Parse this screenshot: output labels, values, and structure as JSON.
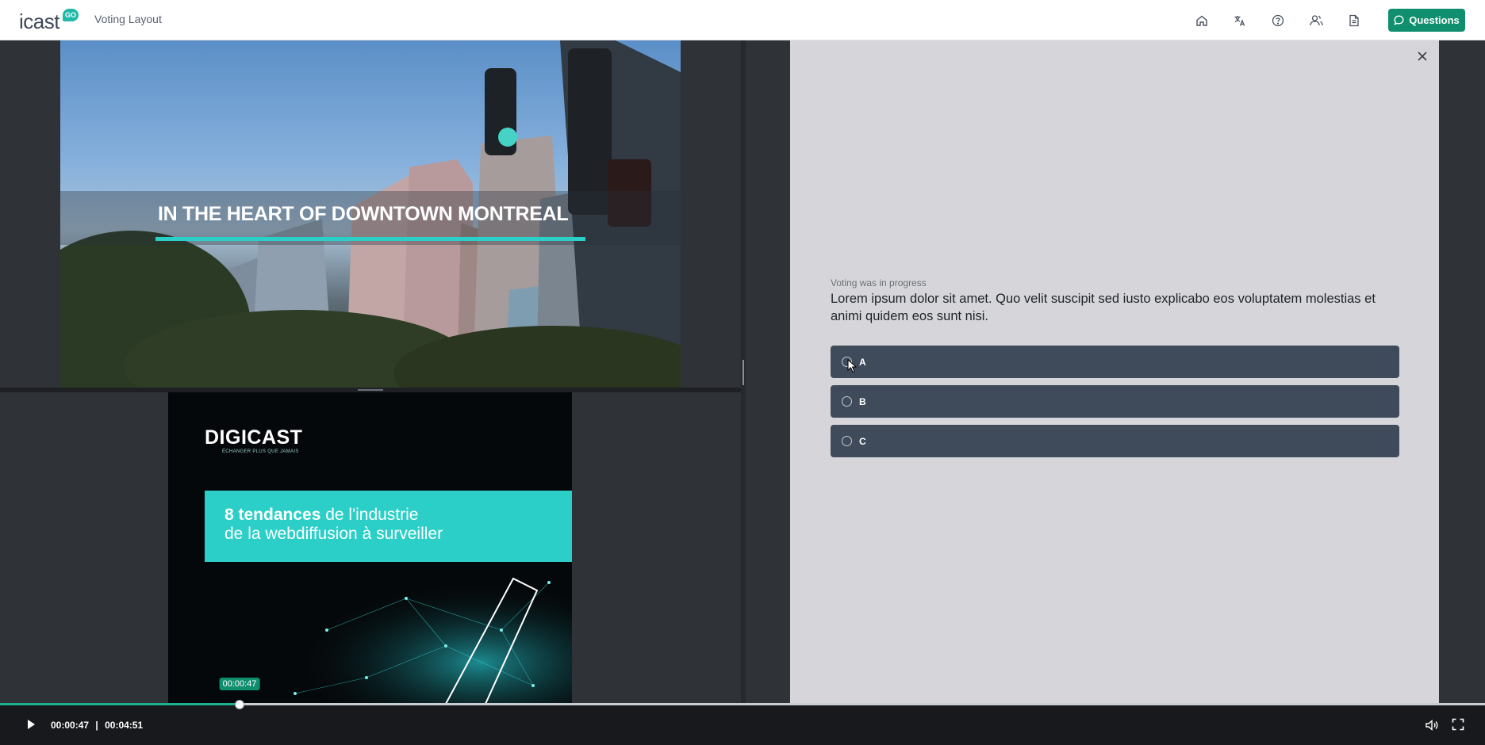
{
  "header": {
    "logo_text": "icast",
    "logo_badge": "GO",
    "page_title": "Voting Layout",
    "questions_label": "Questions",
    "nav_icons": [
      "home-icon",
      "translate-icon",
      "help-icon",
      "users-icon",
      "document-icon"
    ]
  },
  "media": {
    "video_caption": "IN THE HEART OF DOWNTOWN MONTREAL",
    "slide_brand": "DIGICAST",
    "slide_tagline": "ÉCHANGER PLUS QUE JAMAIS",
    "slide_headline_bold": "8 tendances",
    "slide_headline_rest": " de l'industrie",
    "slide_headline_line2": "de la webdiffusion à surveiller"
  },
  "voting": {
    "status": "Voting was in progress",
    "question": "Lorem ipsum dolor sit amet. Quo velit suscipit sed iusto explicabo eos voluptatem molestias et animi quidem eos sunt nisi.",
    "options": [
      {
        "label": "A"
      },
      {
        "label": "B"
      },
      {
        "label": "C"
      }
    ]
  },
  "player": {
    "current_time": "00:00:47",
    "separator": "|",
    "duration": "00:04:51",
    "tooltip_time": "00:00:47",
    "progress": 0.1615
  },
  "colors": {
    "accent": "#0f8f6e",
    "teal": "#2ccfc7",
    "option_bg": "#3f4a5a",
    "panel_bg": "#d6d6da"
  }
}
